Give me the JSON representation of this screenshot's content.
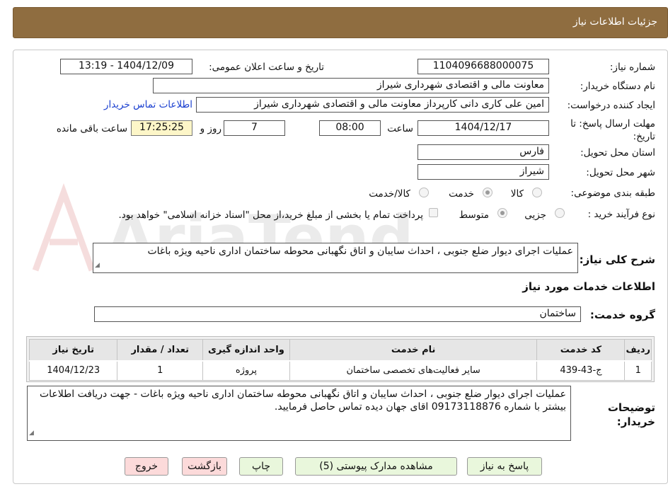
{
  "header": {
    "title": "جزئيات اطلاعات نياز"
  },
  "fields": {
    "need_number_label": "شماره نیاز:",
    "need_number": "1104096688000075",
    "announce_label": "تاریخ و ساعت اعلان عمومی:",
    "announce_value": "1404/12/09 - 13:19",
    "buyer_org_label": "نام دستگاه خریدار:",
    "buyer_org": "معاونت مالی و اقتصادی شهرداری شیراز",
    "creator_label": "ایجاد کننده درخواست:",
    "creator": "امین علی کاری دانی کارپرداز معاونت مالی و اقتصادی شهرداری شیراز",
    "contact_link": "اطلاعات تماس خریدار",
    "deadline_label": "مهلت ارسال پاسخ: تا تاریخ:",
    "deadline_date": "1404/12/17",
    "time_label": "ساعت",
    "deadline_time": "08:00",
    "days_value": "7",
    "days_label": "روز و",
    "remaining_time": "17:25:25",
    "remaining_label": "ساعت باقی مانده",
    "province_label": "استان محل تحویل:",
    "province": "فارس",
    "city_label": "شهر محل تحویل:",
    "city": "شیراز",
    "category_label": "طبقه بندی موضوعی:",
    "category_options": [
      "کالا",
      "خدمت",
      "کالا/خدمت"
    ],
    "category_selected": "خدمت",
    "process_label": "نوع فرآیند خرید :",
    "process_options": [
      "جزیی",
      "متوسط"
    ],
    "process_selected": "متوسط",
    "payment_note": "پرداخت تمام یا بخشی از مبلغ خرید،از محل \"اسناد خزانه اسلامی\" خواهد بود.",
    "description_label": "شرح کلی نیاز:",
    "description": "عملیات اجرای دیوار ضلع جنوبی ، احداث سایبان و اتاق نگهبانی محوطه ساختمان اداری ناحیه ویژه باغات",
    "services_heading": "اطلاعات خدمات مورد نیاز",
    "service_group_label": "گروه خدمت:",
    "service_group": "ساختمان"
  },
  "table": {
    "columns": [
      "ردیف",
      "کد خدمت",
      "نام خدمت",
      "واحد اندازه گیری",
      "تعداد / مقدار",
      "تاریخ نیاز"
    ],
    "rows": [
      [
        "1",
        "ج-43-439",
        "سایر فعالیت‌های تخصصی ساختمان",
        "پروژه",
        "1",
        "1404/12/23"
      ]
    ]
  },
  "buyer_notes": {
    "label": "توضیحات خریدار:",
    "text": "عملیات اجرای دیوار ضلع جنوبی ، احداث سایبان و اتاق نگهبانی محوطه ساختمان اداری ناحیه ویژه باغات - جهت دریافت اطلاعات بیشتر با شماره 09173118876  اقای جهان دیده تماس حاصل فرمایید."
  },
  "buttons": {
    "reply": "پاسخ به نیاز",
    "attachments": "مشاهده مدارک پیوستی (5)",
    "print": "چاپ",
    "back": "بازگشت",
    "exit": "خروج"
  },
  "watermark": "AriaTender.neT",
  "colors": {
    "header_bg": "#8f6d40",
    "link": "#1a3fd0",
    "highlight": "#fdf6c8",
    "btn_green": "#e9f7dc",
    "btn_red": "#fcdada"
  }
}
